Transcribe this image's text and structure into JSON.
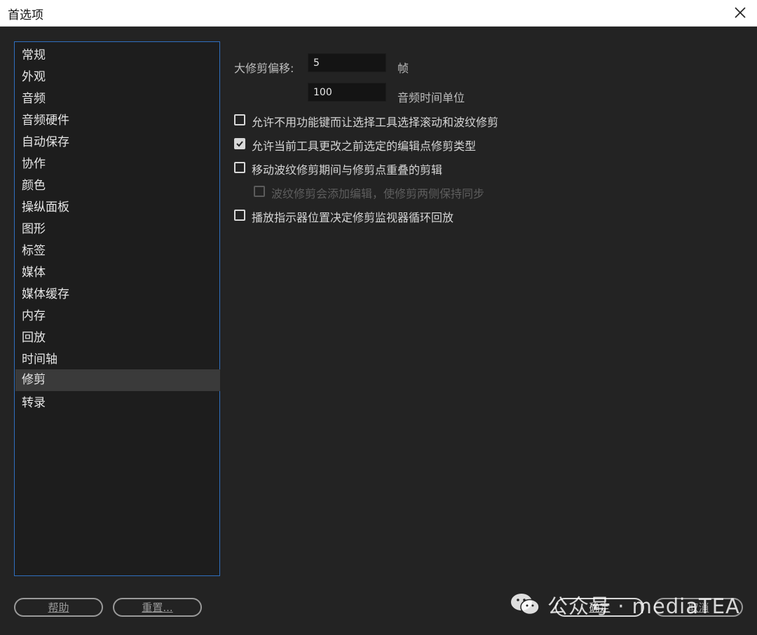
{
  "window": {
    "title": "首选项",
    "close_icon": "close-icon"
  },
  "sidebar": {
    "items": [
      {
        "label": "常规"
      },
      {
        "label": "外观"
      },
      {
        "label": "音频"
      },
      {
        "label": "音频硬件"
      },
      {
        "label": "自动保存"
      },
      {
        "label": "协作"
      },
      {
        "label": "颜色"
      },
      {
        "label": "操纵面板"
      },
      {
        "label": "图形"
      },
      {
        "label": "标签"
      },
      {
        "label": "媒体"
      },
      {
        "label": "媒体缓存"
      },
      {
        "label": "内存"
      },
      {
        "label": "回放"
      },
      {
        "label": "时间轴"
      },
      {
        "label": "修剪",
        "selected": true
      },
      {
        "label": "转录"
      }
    ]
  },
  "trim": {
    "large_trim_offset_label": "大修剪偏移:",
    "frames_value": "5",
    "frames_unit": "帧",
    "audio_value": "100",
    "audio_unit": "音频时间单位",
    "options": [
      {
        "label": "允许不用功能键而让选择工具选择滚动和波纹修剪",
        "checked": false,
        "enabled": true
      },
      {
        "label": "允许当前工具更改之前选定的编辑点修剪类型",
        "checked": true,
        "enabled": true
      },
      {
        "label": "移动波纹修剪期间与修剪点重叠的剪辑",
        "checked": false,
        "enabled": true
      },
      {
        "label": "波纹修剪会添加编辑，使修剪两侧保持同步",
        "checked": false,
        "enabled": false
      },
      {
        "label": "播放指示器位置决定修剪监视器循环回放",
        "checked": false,
        "enabled": true
      }
    ]
  },
  "footer": {
    "help_label": "帮助",
    "reset_label": "重置...",
    "ok_label": "确定",
    "cancel_label": "取消"
  },
  "watermark": {
    "text": "公众号 · mediaTEA",
    "icon": "wechat-icon"
  },
  "colors": {
    "accent_border": "#2f6fbf",
    "background": "#232323",
    "selected_item": "#3a3a3a"
  }
}
